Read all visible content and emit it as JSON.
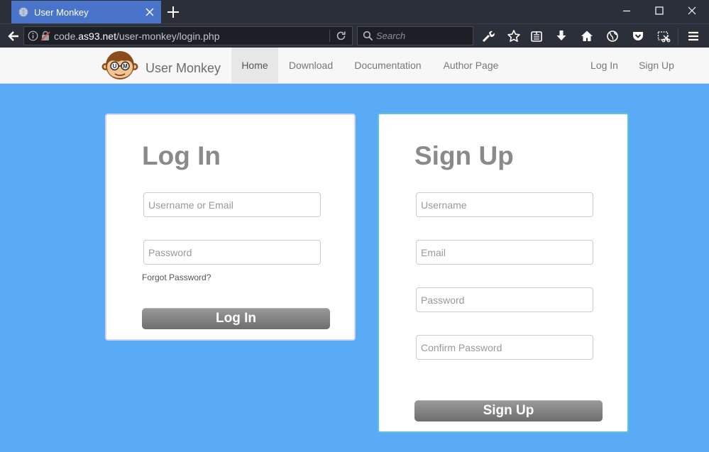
{
  "browser": {
    "tab_title": "User Monkey",
    "url_prefix": "code.",
    "url_host": "as93.net",
    "url_path": "/user-monkey/login.php",
    "search_placeholder": "Search",
    "colors": {
      "chrome_bg": "#2b2f3a",
      "active_tab": "#4a74c9",
      "field_bg": "#1c1f26"
    }
  },
  "site": {
    "brand": "User Monkey",
    "logo_letters": [
      "U",
      "M"
    ],
    "nav_left": [
      "Home",
      "Download",
      "Documentation",
      "Author Page"
    ],
    "nav_right": [
      "Log In",
      "Sign Up"
    ],
    "active_nav": "Home",
    "colors": {
      "page_bg": "#5aabf6",
      "signup_border": "#5ec3d8"
    }
  },
  "login": {
    "title": "Log In",
    "username_placeholder": "Username or Email",
    "password_placeholder": "Password",
    "forgot": "Forgot Password?",
    "button": "Log In"
  },
  "signup": {
    "title": "Sign Up",
    "username_placeholder": "Username",
    "email_placeholder": "Email",
    "password_placeholder": "Password",
    "confirm_placeholder": "Confirm Password",
    "button": "Sign Up"
  }
}
